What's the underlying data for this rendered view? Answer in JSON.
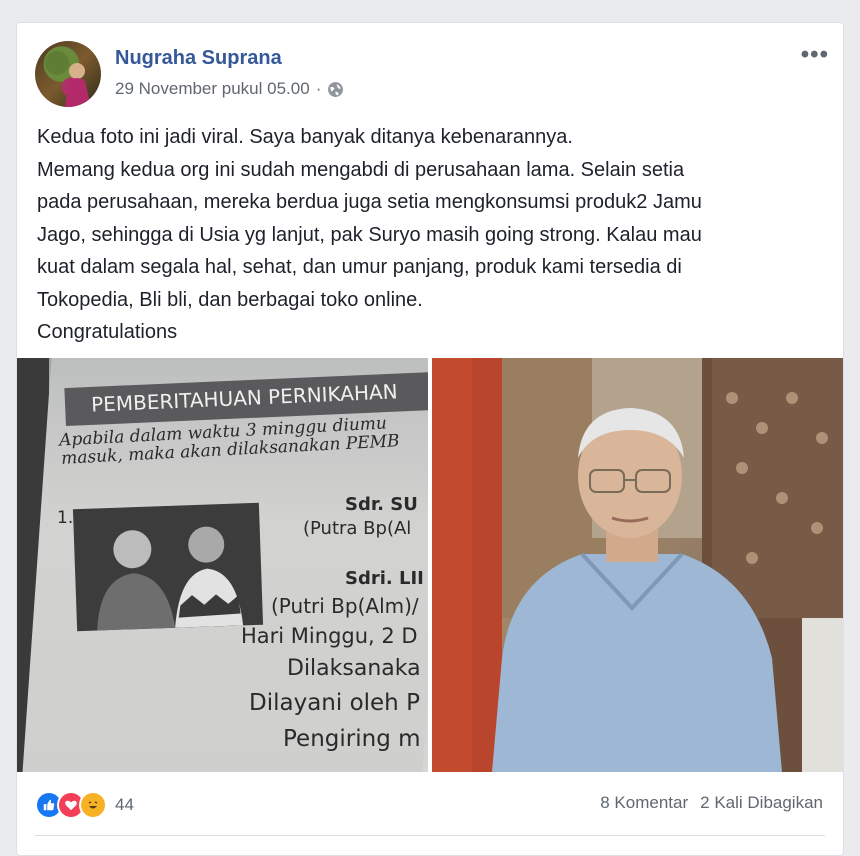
{
  "post": {
    "author": "Nugraha Suprana",
    "timestamp": "29 November pukul 05.00",
    "separator": "·",
    "privacy_icon": "globe-icon",
    "more_label": "•••",
    "text_lines": [
      "Kedua foto ini jadi viral. Saya banyak ditanya kebenarannya.",
      "Memang kedua org ini sudah mengabdi di perusahaan lama. Selain setia",
      "pada perusahaan, mereka berdua juga setia mengkonsumsi produk2 Jamu",
      "Jago, sehingga di Usia yg lanjut, pak Suryo masih going strong. Kalau mau",
      "kuat dalam segala hal, sehat, dan umur panjang, produk kami tersedia di",
      "Tokopedia, Bli bli, dan berbagai toko online.",
      "Congratulations"
    ]
  },
  "photo_left": {
    "header": "PEMBERITAHUAN PERNIKAHAN",
    "line1": "Apabila dalam waktu 3 minggu diumu",
    "line2": "masuk, maka akan dilaksanakan PEMB",
    "item_no": "1.",
    "groom": "Sdr. SU",
    "groom_parent": "(Putra Bp(Al",
    "bride": "Sdri. LII",
    "bride_parent": "(Putri Bp(Alm)/",
    "day": "Hari Minggu, 2 D",
    "place": "Dilaksanaka",
    "officiant": "Dilayani oleh P",
    "escort": "Pengiring m"
  },
  "footer": {
    "reaction_count": "44",
    "comments": "8 Komentar",
    "shares": "2 Kali Dibagikan"
  },
  "colors": {
    "author": "#365899",
    "meta": "#616770",
    "like": "#1877f2",
    "love": "#f33e58",
    "haha": "#f7b125"
  }
}
